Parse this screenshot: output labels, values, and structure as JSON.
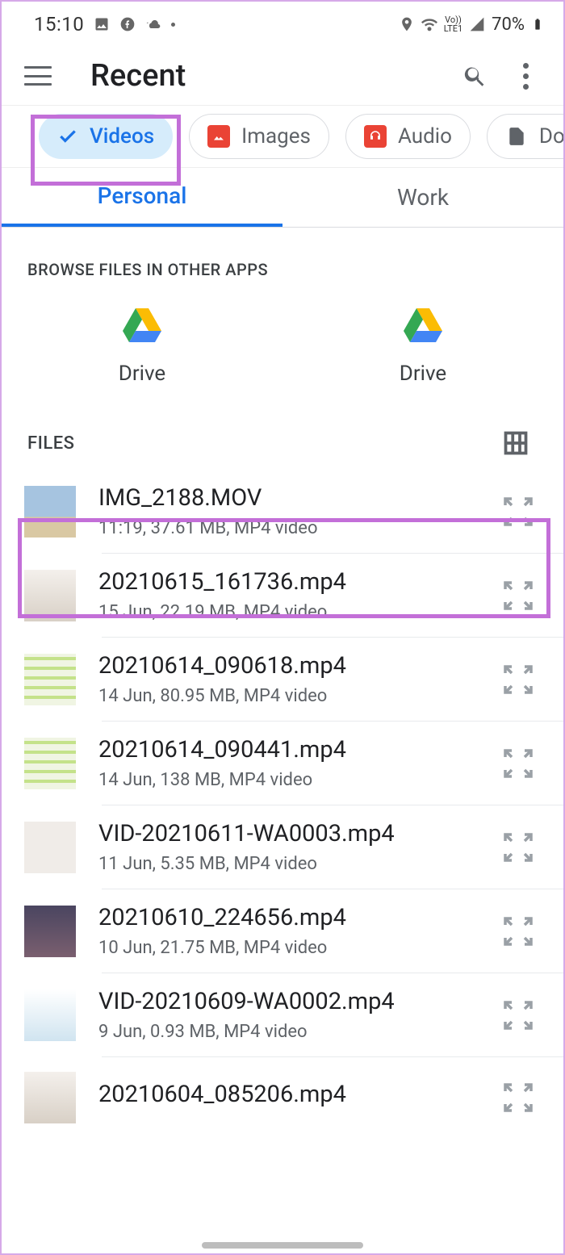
{
  "status": {
    "time": "15:10",
    "battery": "70%"
  },
  "appbar": {
    "title": "Recent"
  },
  "chips": [
    {
      "label": "Videos",
      "selected": true
    },
    {
      "label": "Images",
      "selected": false
    },
    {
      "label": "Audio",
      "selected": false
    },
    {
      "label": "Doc",
      "selected": false
    }
  ],
  "tabs": {
    "personal": "Personal",
    "work": "Work",
    "active": "personal"
  },
  "sections": {
    "browse_label": "BROWSE FILES IN OTHER APPS",
    "files_label": "FILES"
  },
  "other_apps": [
    {
      "label": "Drive"
    },
    {
      "label": "Drive"
    }
  ],
  "files": [
    {
      "name": "IMG_2188.MOV",
      "sub": "11:19, 37.61 MB, MP4 video",
      "thumb": "th-sky"
    },
    {
      "name": "20210615_161736.mp4",
      "sub": "15 Jun, 22.19 MB, MP4 video",
      "thumb": "th-room"
    },
    {
      "name": "20210614_090618.mp4",
      "sub": "14 Jun, 80.95 MB, MP4 video",
      "thumb": "th-chat"
    },
    {
      "name": "20210614_090441.mp4",
      "sub": "14 Jun, 138 MB, MP4 video",
      "thumb": "th-chat"
    },
    {
      "name": "VID-20210611-WA0003.mp4",
      "sub": "11 Jun, 5.35 MB, MP4 video",
      "thumb": "th-temp"
    },
    {
      "name": "20210610_224656.mp4",
      "sub": "10 Jun, 21.75 MB, MP4 video",
      "thumb": "th-store"
    },
    {
      "name": "VID-20210609-WA0002.mp4",
      "sub": "9 Jun, 0.93 MB, MP4 video",
      "thumb": "th-girl"
    },
    {
      "name": "20210604_085206.mp4",
      "sub": "",
      "thumb": "th-room"
    }
  ]
}
